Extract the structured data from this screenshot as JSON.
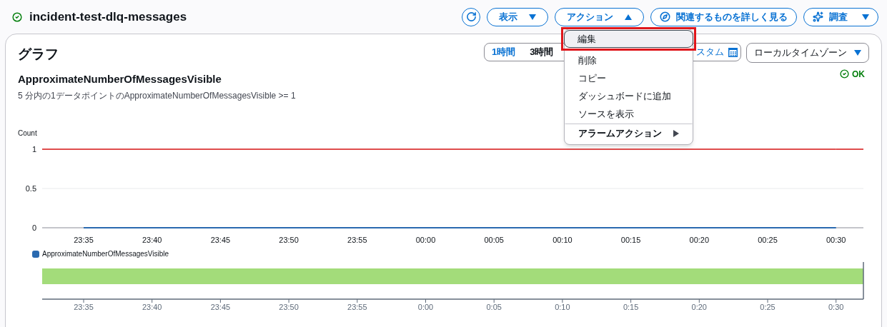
{
  "header": {
    "title": "incident-test-dlq-messages",
    "ok": true,
    "buttons": [
      {
        "kind": "icon"
      },
      {
        "kind": "dropdown",
        "label": "表示",
        "expanded": false
      },
      {
        "kind": "dropdown",
        "label": "アクション",
        "expanded": true
      },
      {
        "kind": "compass",
        "label": "関連するものを詳しく見る"
      },
      {
        "kind": "sparkle-dropdown",
        "label": "調査",
        "expanded": false
      }
    ]
  },
  "actions_menu": {
    "items": [
      {
        "kind": "item",
        "label": "編集",
        "selected": true,
        "annotated": true
      },
      {
        "kind": "item",
        "label": "削除",
        "selected": false,
        "annotated": false
      },
      {
        "kind": "item",
        "label": "コピー",
        "selected": false,
        "annotated": false
      },
      {
        "kind": "item",
        "label": "ダッシュボードに追加",
        "selected": false,
        "annotated": false
      },
      {
        "kind": "item",
        "label": "ソースを表示",
        "selected": false,
        "annotated": false
      },
      {
        "kind": "submenu",
        "label": "アラームアクション",
        "selected": false,
        "annotated": false
      }
    ]
  },
  "panel": {
    "title": "グラフ",
    "time_ranges": [
      {
        "label": "1時間",
        "selected": true
      },
      {
        "label": "3時間",
        "selected": false
      }
    ],
    "custom_range": "スタム",
    "timezone": "ローカルタイムゾーン",
    "metric_title": "ApproximateNumberOfMessagesVisible",
    "condition": "5 分内の1データポイントのApproximateNumberOfMessagesVisible >= 1",
    "alarm_state": "OK",
    "chart_data": {
      "type": "line",
      "ylabel": "Count",
      "x": [
        "23:35",
        "23:40",
        "23:45",
        "23:50",
        "23:55",
        "00:00",
        "00:05",
        "00:10",
        "00:15",
        "00:20",
        "00:25",
        "00:30"
      ],
      "series": [
        {
          "name": "ApproximateNumberOfMessagesVisible",
          "color": "#2a6ab0",
          "values": [
            0,
            0,
            0,
            0,
            0,
            0,
            0,
            0,
            0,
            0,
            0,
            0
          ]
        },
        {
          "color": "#d91515",
          "values": [
            1,
            1,
            1,
            1,
            1,
            1,
            1,
            1,
            1,
            1,
            1,
            1
          ]
        }
      ],
      "ylim": [
        0,
        1
      ],
      "yticks": [
        0,
        0.5,
        1
      ]
    },
    "state_timeline": {
      "color": "#a3dc7a",
      "ticks": [
        "23:35",
        "23:40",
        "23:45",
        "23:50",
        "23:55",
        "0:00",
        "0:05",
        "0:10",
        "0:15",
        "0:20",
        "0:25",
        "0:30"
      ]
    }
  }
}
